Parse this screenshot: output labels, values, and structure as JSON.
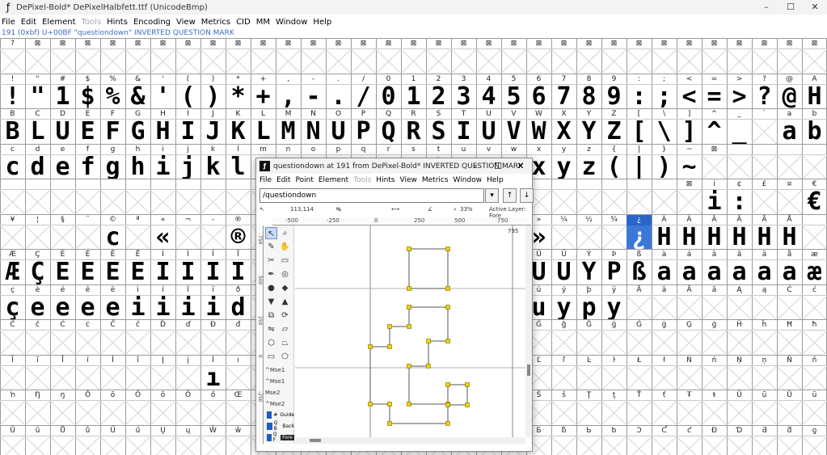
{
  "window": {
    "title": "DePixel-Bold*  DePixelHalbfett.ttf (UnicodeBmp)",
    "controls": [
      "–",
      "☐",
      "✕"
    ]
  },
  "menu": {
    "items": [
      "File",
      "Edit",
      "Element",
      "Tools",
      "Hints",
      "Encoding",
      "View",
      "Metrics",
      "CID",
      "MM",
      "Window",
      "Help"
    ],
    "disabled": [
      "Tools"
    ]
  },
  "info_line": "191 (0xbf) U+00BF \"questiondown\" INVERTED QUESTION MARK",
  "grid_rows": [
    {
      "labels": [
        "?",
        "⊠",
        "⊠",
        "⊠",
        "⊠",
        "⊠",
        "⊠",
        "⊠",
        "⊠",
        "⊠",
        "⊠",
        "⊠",
        "⊠",
        "⊠",
        "⊠",
        "⊠",
        "⊠",
        "⊠",
        "⊠",
        "⊠",
        "⊠",
        "⊠",
        "⊠",
        "⊠",
        "⊠",
        "⊠",
        "⊠",
        "⊠",
        "⊠",
        "⊠",
        "⊠",
        "⊠",
        "⊠"
      ],
      "glyphs": [
        "",
        "",
        "",
        "",
        "",
        "",
        "",
        "",
        "",
        "",
        "",
        "",
        "",
        "",
        "",
        "",
        "",
        "",
        "",
        "",
        "",
        "",
        "",
        "",
        "",
        "",
        "",
        "",
        "",
        "",
        "",
        "",
        ""
      ]
    },
    {
      "labels": [
        "!",
        "\"",
        "#",
        "$",
        "%",
        "&",
        "'",
        "(",
        ")",
        "*",
        "+",
        ",",
        "-",
        ".",
        "/",
        "0",
        "1",
        "2",
        "3",
        "4",
        "5",
        "6",
        "7",
        "8",
        "9",
        ":",
        ";",
        "<",
        "=",
        ">",
        "?",
        "@",
        "A"
      ],
      "glyphs": [
        "!",
        "\"",
        "1",
        "$",
        "%",
        "&",
        "'",
        "(",
        ")",
        "*",
        "+",
        ",",
        "-",
        ".",
        "/",
        "0",
        "1",
        "2",
        "3",
        "4",
        "5",
        "6",
        "7",
        "8",
        "9",
        ":",
        ";",
        "<",
        "=",
        ">",
        "?",
        "@",
        "H"
      ]
    },
    {
      "labels": [
        "B",
        "C",
        "D",
        "E",
        "F",
        "G",
        "H",
        "I",
        "J",
        "K",
        "L",
        "M",
        "N",
        "O",
        "P",
        "Q",
        "R",
        "S",
        "T",
        "U",
        "V",
        "W",
        "X",
        "Y",
        "Z",
        "[",
        "\\",
        "]",
        "^",
        "_",
        "`",
        "a",
        "b"
      ],
      "glyphs": [
        "B",
        "L",
        "U",
        "E",
        "F",
        "G",
        "H",
        "I",
        "J",
        "K",
        "L",
        "M",
        "N",
        "U",
        "P",
        "Q",
        "R",
        "S",
        "I",
        "U",
        "V",
        "W",
        "X",
        "Y",
        "Z",
        "[",
        "\\",
        "]",
        "^",
        "_",
        "",
        "a",
        "b"
      ]
    },
    {
      "labels": [
        "c",
        "d",
        "e",
        "f",
        "g",
        "h",
        "i",
        "j",
        "k",
        "l",
        "m",
        "n",
        "o",
        "p",
        "q",
        "r",
        "s",
        "t",
        "u",
        "v",
        "w",
        "x",
        "y",
        "z",
        "{",
        "|",
        "}",
        "~",
        "⊠",
        "",
        "",
        "",
        ""
      ],
      "glyphs": [
        "c",
        "d",
        "e",
        "f",
        "g",
        "h",
        "i",
        "j",
        "k",
        "l",
        "m",
        "n",
        "o",
        "p",
        "q",
        "r",
        "s",
        "t",
        "u",
        "v",
        "w",
        "x",
        "y",
        "z",
        "(",
        "|",
        ")",
        "~",
        "",
        "",
        "",
        "",
        ""
      ]
    },
    {
      "labels": [
        "",
        "",
        "",
        "",
        "",
        "",
        "",
        "",
        "",
        "",
        "",
        "",
        "",
        "",
        "",
        "",
        "",
        "",
        "",
        "",
        "",
        "",
        "",
        "",
        "",
        "",
        "",
        "⊠",
        "i",
        "¢",
        "£",
        "¤",
        "€"
      ],
      "glyphs": [
        "",
        "",
        "",
        "",
        "",
        "",
        "",
        "",
        "",
        "",
        "",
        "",
        "",
        "",
        "",
        "",
        "",
        "",
        "",
        "",
        "",
        "",
        "",
        "",
        "",
        "",
        "",
        "",
        "i",
        ":",
        "",
        "",
        "€"
      ]
    },
    {
      "labels": [
        "¥",
        "¦",
        "§",
        "¨",
        "©",
        "ª",
        "«",
        "¬",
        "-",
        "®",
        "",
        "",
        "",
        "",
        "",
        "",
        "",
        "",
        "",
        "",
        "",
        "»",
        "¼",
        "½",
        "¾",
        "¿",
        "À",
        "Á",
        "Â",
        "Ã",
        "Ä",
        "Å",
        ""
      ],
      "glyphs": [
        "",
        "",
        "",
        "",
        "c",
        "",
        "«",
        "",
        "",
        "®",
        "",
        "",
        "",
        "",
        "",
        "",
        "",
        "",
        "",
        "",
        "",
        "»",
        "",
        "",
        "",
        "¿",
        "H",
        "H",
        "H",
        "H",
        "H",
        "H",
        ""
      ]
    },
    {
      "labels": [
        "Æ",
        "Ç",
        "È",
        "É",
        "Ê",
        "Ë",
        "Ì",
        "Í",
        "Î",
        "Ï",
        "",
        "",
        "",
        "",
        "",
        "",
        "",
        "",
        "",
        "",
        "",
        "Û",
        "Ü",
        "Ý",
        "Þ",
        "ß",
        "à",
        "á",
        "â",
        "ã",
        "ä",
        "å",
        "æ"
      ],
      "glyphs": [
        "Æ",
        "Ç",
        "E",
        "E",
        "E",
        "E",
        "I",
        "I",
        "I",
        "I",
        "",
        "",
        "",
        "",
        "",
        "",
        "",
        "",
        "",
        "",
        "",
        "U",
        "U",
        "Y",
        "P",
        "ß",
        "a",
        "a",
        "a",
        "a",
        "a",
        "a",
        "æ"
      ]
    },
    {
      "labels": [
        "ç",
        "è",
        "é",
        "ê",
        "ë",
        "ì",
        "í",
        "î",
        "ï",
        "ð",
        "",
        "",
        "",
        "",
        "",
        "",
        "",
        "",
        "",
        "",
        "",
        "ú",
        "ý",
        "þ",
        "ÿ",
        "Ā",
        "ā",
        "Ă",
        "ă",
        "Ą",
        "ą",
        "Ć",
        "ć"
      ],
      "glyphs": [
        "ç",
        "e",
        "e",
        "e",
        "e",
        "i",
        "i",
        "i",
        "i",
        "d",
        "",
        "",
        "",
        "",
        "",
        "",
        "",
        "",
        "",
        "",
        "",
        "u",
        "y",
        "p",
        "y",
        "",
        "",
        "",
        "",
        "",
        "",
        "",
        ""
      ]
    },
    {
      "labels": [
        "Ĉ",
        "ĉ",
        "Ċ",
        "ċ",
        "Č",
        "č",
        "Ď",
        "ď",
        "Đ",
        "đ",
        "",
        "",
        "",
        "",
        "",
        "",
        "",
        "",
        "",
        "",
        "",
        "Ĝ",
        "ĝ",
        "Ğ",
        "ğ",
        "Ġ",
        "ġ",
        "Ģ",
        "ģ",
        "Ĥ",
        "ĥ",
        "Ħ",
        "ħ"
      ],
      "glyphs": [
        "",
        "",
        "",
        "",
        "",
        "",
        "",
        "",
        "",
        "",
        "",
        "",
        "",
        "",
        "",
        "",
        "",
        "",
        "",
        "",
        "",
        "",
        "",
        "",
        "",
        "",
        "",
        "",
        "",
        "",
        "",
        "",
        ""
      ]
    },
    {
      "labels": [
        "Ĩ",
        "ĩ",
        "Ī",
        "ī",
        "Ĭ",
        "ĭ",
        "Į",
        "į",
        "İ",
        "ı",
        "Ĳ",
        "",
        "",
        "",
        "",
        "",
        "",
        "",
        "",
        "",
        "",
        "Ľ",
        "ľ",
        "Ŀ",
        "ŀ",
        "Ł",
        "ł",
        "Ń",
        "ń",
        "Ņ",
        "ņ",
        "Ň",
        "ň"
      ],
      "glyphs": [
        "",
        "",
        "",
        "",
        "",
        "",
        "",
        "",
        "ı",
        "",
        "",
        "",
        "",
        "",
        "",
        "",
        "",
        "",
        "",
        "",
        "",
        "",
        "",
        "",
        "",
        "",
        "",
        "",
        "",
        "",
        "",
        "",
        ""
      ]
    },
    {
      "labels": [
        "ŉ",
        "Ŋ",
        "ŋ",
        "Ō",
        "ō",
        "Ŏ",
        "ŏ",
        "Ő",
        "ő",
        "Œ",
        "œ",
        "",
        "",
        "",
        "",
        "",
        "",
        "",
        "",
        "",
        "",
        "Š",
        "š",
        "Ţ",
        "ţ",
        "Ť",
        "ť",
        "Ŧ",
        "ŧ",
        "Ũ",
        "ũ",
        "Ū",
        "ū"
      ],
      "glyphs": [
        "",
        "",
        "",
        "",
        "",
        "",
        "",
        "",
        "",
        "",
        "",
        "",
        "",
        "",
        "",
        "",
        "",
        "",
        "",
        "",
        "",
        "",
        "",
        "",
        "",
        "",
        "",
        "",
        "",
        "",
        "",
        "",
        ""
      ]
    },
    {
      "labels": [
        "Ŭ",
        "ŭ",
        "Ů",
        "ů",
        "Ű",
        "ű",
        "Ų",
        "ų",
        "Ŵ",
        "ŵ",
        "Ŷ",
        "",
        "",
        "",
        "",
        "",
        "",
        "",
        "",
        "",
        "",
        "Ƃ",
        "ƃ",
        "Ƅ",
        "ƅ",
        "Ɔ",
        "Ƈ",
        "ƈ",
        "Ɖ",
        "Ɗ",
        "Ƌ",
        "ƌ",
        "ƍ"
      ],
      "glyphs": [
        "",
        "",
        "",
        "",
        "",
        "",
        "",
        "",
        "",
        "",
        "",
        "",
        "",
        "",
        "",
        "",
        "",
        "",
        "",
        "",
        "",
        "",
        "",
        "",
        "",
        "",
        "",
        "",
        "",
        "",
        "",
        "",
        ""
      ]
    }
  ],
  "selected_cell": {
    "row": 5,
    "col": 25
  },
  "glyph_window": {
    "title": "questiondown at 191 from DePixel-Bold* INVERTED QUESTION MARK",
    "controls": [
      "–",
      "☐",
      "✕"
    ],
    "menu_items": [
      "File",
      "Edit",
      "Point",
      "Element",
      "Tools",
      "Hints",
      "View",
      "Metrics",
      "Window",
      "Help"
    ],
    "menu_disabled": [
      "Tools"
    ],
    "search_value": "/questiondown",
    "nav_buttons": [
      "▾",
      "↑",
      "↓"
    ],
    "coord": "113,114",
    "zoom": "33%",
    "active_layer": "Active Layer: Fore",
    "ruler_ticks": [
      "-500",
      "-250",
      "0",
      "250",
      "500",
      "750"
    ],
    "vruler_ticks": [
      "750",
      "500",
      "250",
      "0",
      "-250"
    ],
    "width_marker": "795",
    "mse_labels": [
      "^Mse1",
      "^Mse1",
      "Mse2",
      "^Mse2"
    ],
    "layers": [
      {
        "label": "Guide",
        "prefix": "#"
      },
      {
        "label": "Back",
        "prefix": "Q B"
      },
      {
        "label": "Fore",
        "prefix": "Q F"
      }
    ]
  }
}
